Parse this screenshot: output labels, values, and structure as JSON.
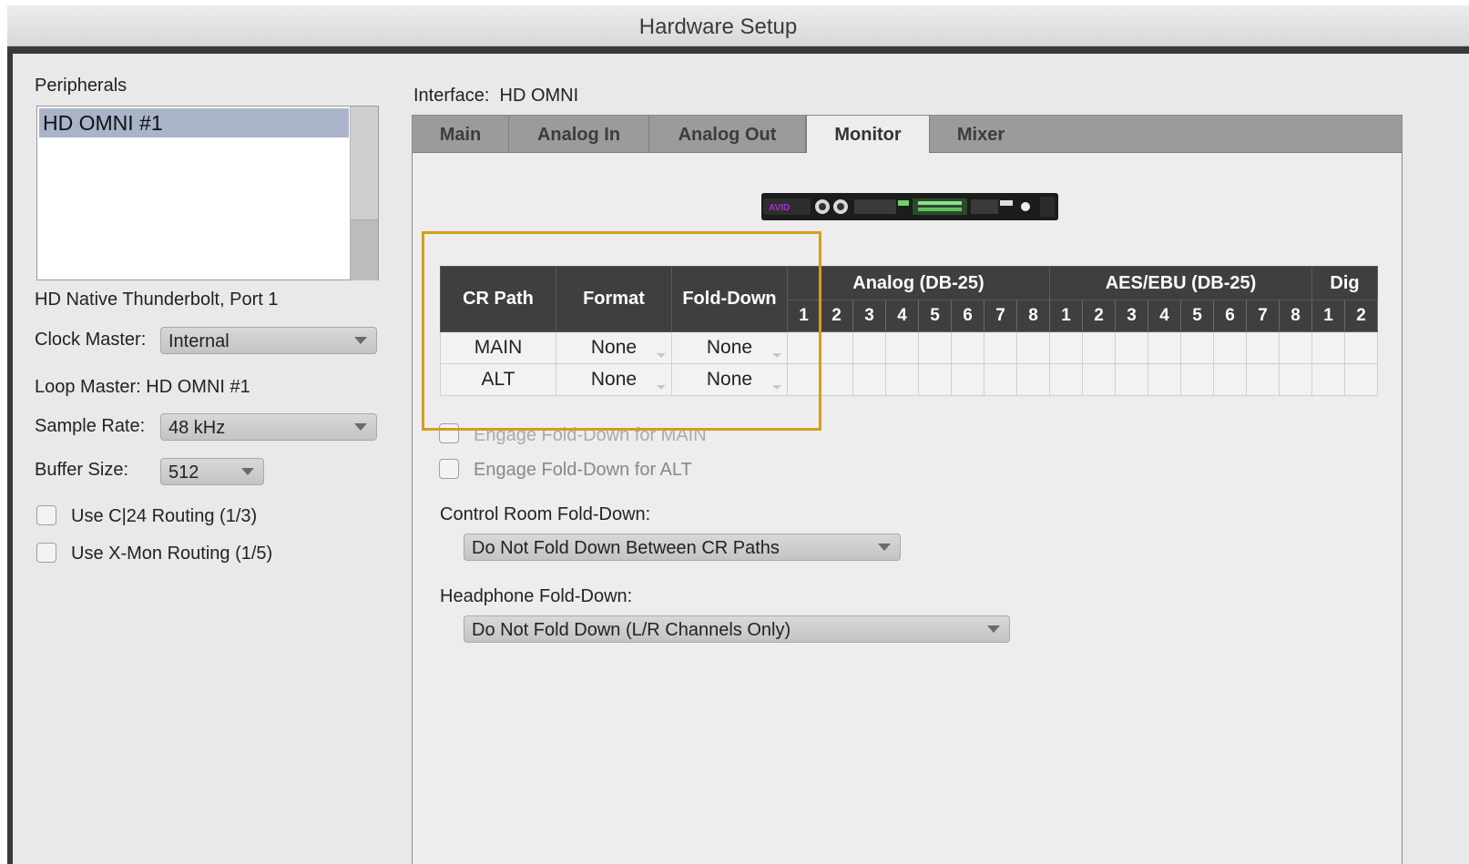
{
  "window": {
    "title": "Hardware Setup"
  },
  "peripherals": {
    "label": "Peripherals",
    "items": [
      "HD OMNI #1"
    ]
  },
  "connection": "HD Native Thunderbolt, Port 1",
  "clock_master": {
    "label": "Clock Master:",
    "value": "Internal"
  },
  "loop_master": "Loop Master: HD OMNI #1",
  "sample_rate": {
    "label": "Sample Rate:",
    "value": "48 kHz"
  },
  "buffer_size": {
    "label": "Buffer Size:",
    "value": "512"
  },
  "routing_options": [
    {
      "label": "Use C|24 Routing (1/3)",
      "checked": false
    },
    {
      "label": "Use X-Mon Routing (1/5)",
      "checked": false
    }
  ],
  "interface": {
    "label": "Interface:",
    "value": "HD OMNI"
  },
  "tabs": [
    "Main",
    "Analog In",
    "Analog Out",
    "Monitor",
    "Mixer"
  ],
  "active_tab": "Monitor",
  "monitor_table": {
    "columns": [
      "CR Path",
      "Format",
      "Fold-Down"
    ],
    "groups": [
      {
        "name": "Analog (DB-25)",
        "channels": [
          "1",
          "2",
          "3",
          "4",
          "5",
          "6",
          "7",
          "8"
        ]
      },
      {
        "name": "AES/EBU (DB-25)",
        "channels": [
          "1",
          "2",
          "3",
          "4",
          "5",
          "6",
          "7",
          "8"
        ]
      },
      {
        "name": "Dig",
        "channels": [
          "1",
          "2"
        ]
      }
    ],
    "rows": [
      {
        "path": "MAIN",
        "format": "None",
        "folddown": "None"
      },
      {
        "path": "ALT",
        "format": "None",
        "folddown": "None"
      }
    ]
  },
  "engage": [
    {
      "label": "Engage Fold-Down for MAIN",
      "checked": false
    },
    {
      "label": "Engage Fold-Down for ALT",
      "checked": false
    }
  ],
  "control_room_folddown": {
    "label": "Control Room Fold-Down:",
    "value": "Do Not Fold Down Between CR Paths"
  },
  "headphone_folddown": {
    "label": "Headphone Fold-Down:",
    "value": "Do Not Fold Down (L/R Channels Only)"
  },
  "colors": {
    "highlight": "#d39e1b",
    "table_header": "#3f3f3f",
    "selection": "#a9b4c9"
  },
  "device_image": {
    "brand": "AVID"
  }
}
